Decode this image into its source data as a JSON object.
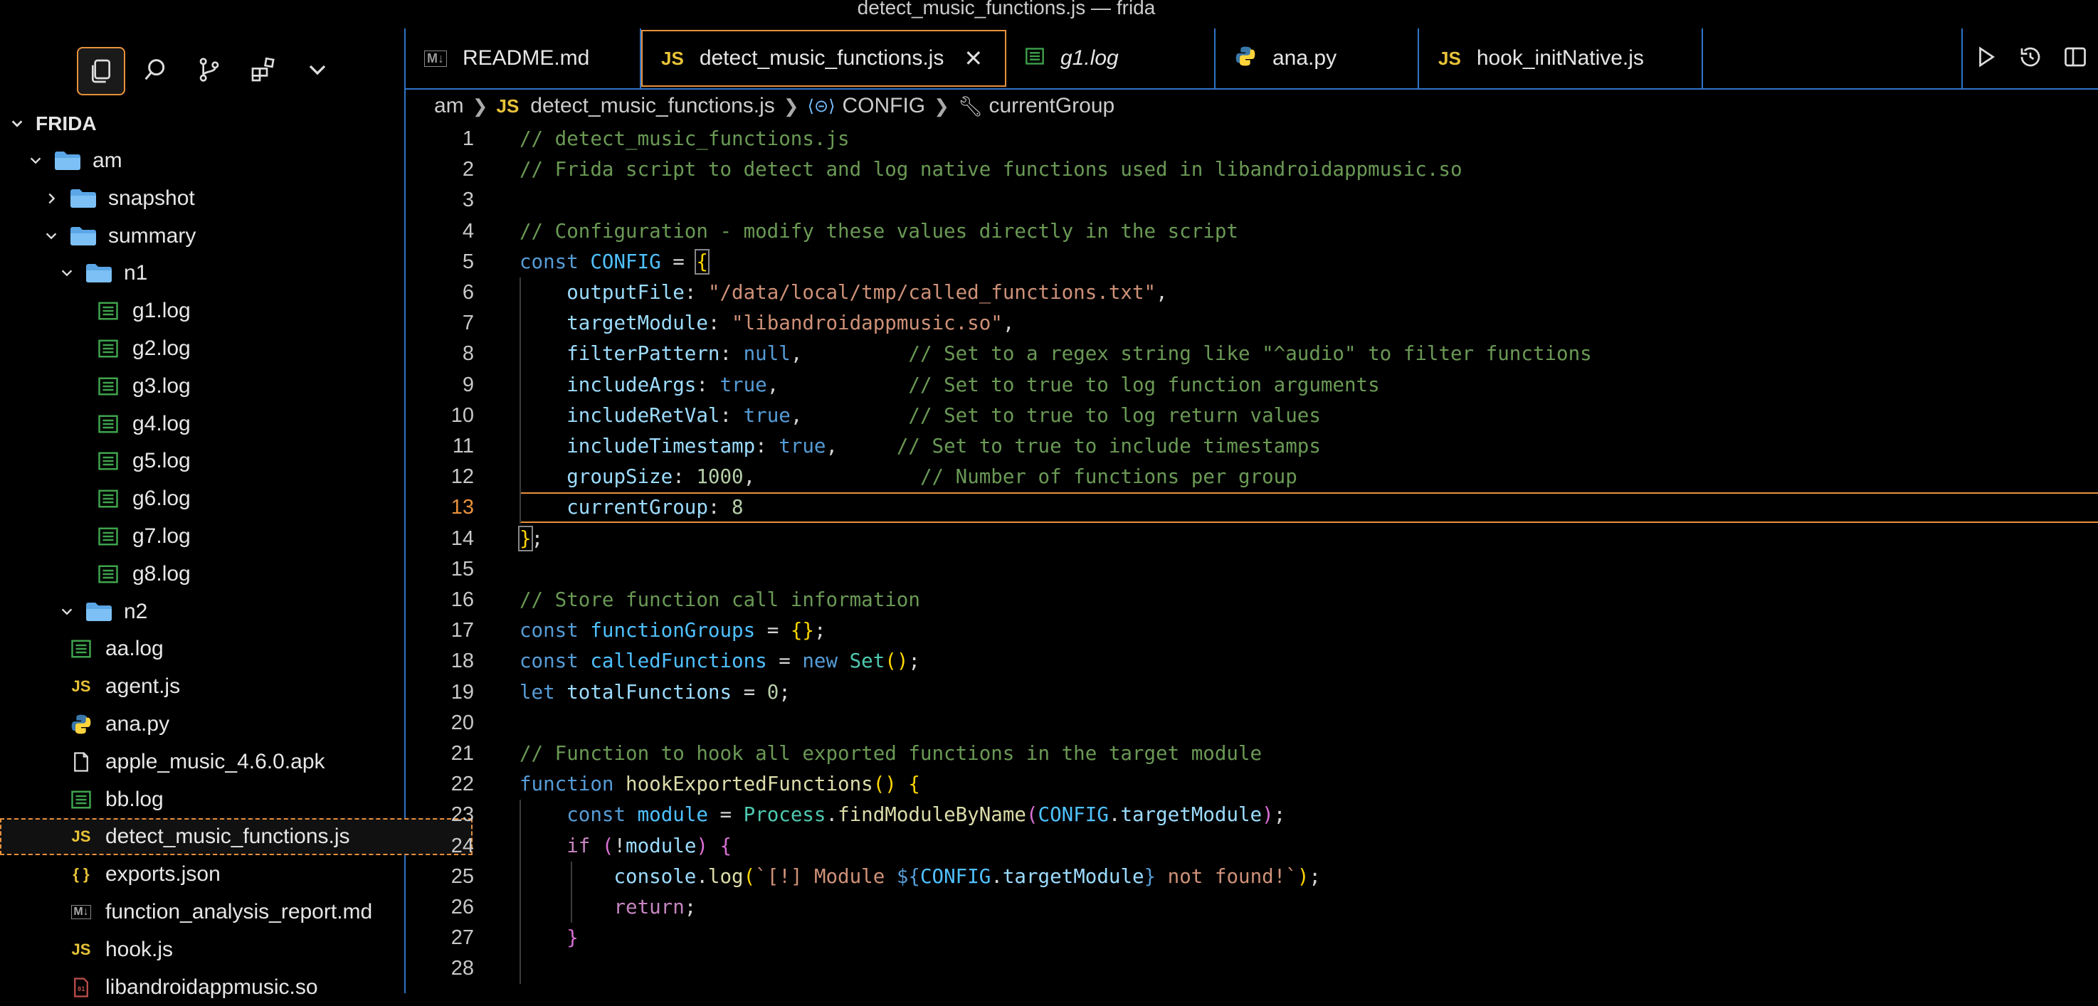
{
  "window": {
    "title": "detect_music_functions.js — frida"
  },
  "activity": {
    "icons": [
      "files-icon",
      "search-icon",
      "source-control-icon",
      "extensions-icon",
      "chevron-down-icon"
    ]
  },
  "explorer": {
    "root": "FRIDA",
    "items": [
      {
        "label": "am",
        "kind": "folder",
        "open": true
      },
      {
        "label": "snapshot",
        "kind": "folder",
        "open": false
      },
      {
        "label": "summary",
        "kind": "folder",
        "open": true
      },
      {
        "label": "n1",
        "kind": "folder",
        "open": true
      },
      {
        "label": "g1.log",
        "kind": "log"
      },
      {
        "label": "g2.log",
        "kind": "log"
      },
      {
        "label": "g3.log",
        "kind": "log"
      },
      {
        "label": "g4.log",
        "kind": "log"
      },
      {
        "label": "g5.log",
        "kind": "log"
      },
      {
        "label": "g6.log",
        "kind": "log"
      },
      {
        "label": "g7.log",
        "kind": "log"
      },
      {
        "label": "g8.log",
        "kind": "log"
      },
      {
        "label": "n2",
        "kind": "folder",
        "open": true
      },
      {
        "label": "aa.log",
        "kind": "log"
      },
      {
        "label": "agent.js",
        "kind": "js"
      },
      {
        "label": "ana.py",
        "kind": "py"
      },
      {
        "label": "apple_music_4.6.0.apk",
        "kind": "file"
      },
      {
        "label": "bb.log",
        "kind": "log"
      },
      {
        "label": "detect_music_functions.js",
        "kind": "js",
        "selected": true
      },
      {
        "label": "exports.json",
        "kind": "json"
      },
      {
        "label": "function_analysis_report.md",
        "kind": "md"
      },
      {
        "label": "hook.js",
        "kind": "js"
      },
      {
        "label": "libandroidappmusic.so",
        "kind": "bin"
      }
    ]
  },
  "tabs": [
    {
      "label": "README.md",
      "icon": "M↓"
    },
    {
      "label": "detect_music_functions.js",
      "icon": "JS",
      "active": true
    },
    {
      "label": "g1.log",
      "icon": "log"
    },
    {
      "label": "ana.py",
      "icon": "py"
    },
    {
      "label": "hook_initNative.js",
      "icon": "JS"
    }
  ],
  "breadcrumb": {
    "folder": "am",
    "file_icon": "JS",
    "file": "detect_music_functions.js",
    "symbol1": "CONFIG",
    "symbol2": "currentGroup"
  },
  "editor": {
    "current_line": 13,
    "line_numbers": [
      "1",
      "2",
      "3",
      "4",
      "5",
      "6",
      "7",
      "8",
      "9",
      "10",
      "11",
      "12",
      "13",
      "14",
      "15",
      "16",
      "17",
      "18",
      "19",
      "20",
      "21",
      "22",
      "23",
      "24",
      "25",
      "26",
      "27",
      "28"
    ]
  },
  "colors": {
    "accent": "#e8913c",
    "border": "#2f75c9",
    "comment": "#6a9955",
    "string": "#ce9178",
    "keyword": "#569cd6"
  }
}
